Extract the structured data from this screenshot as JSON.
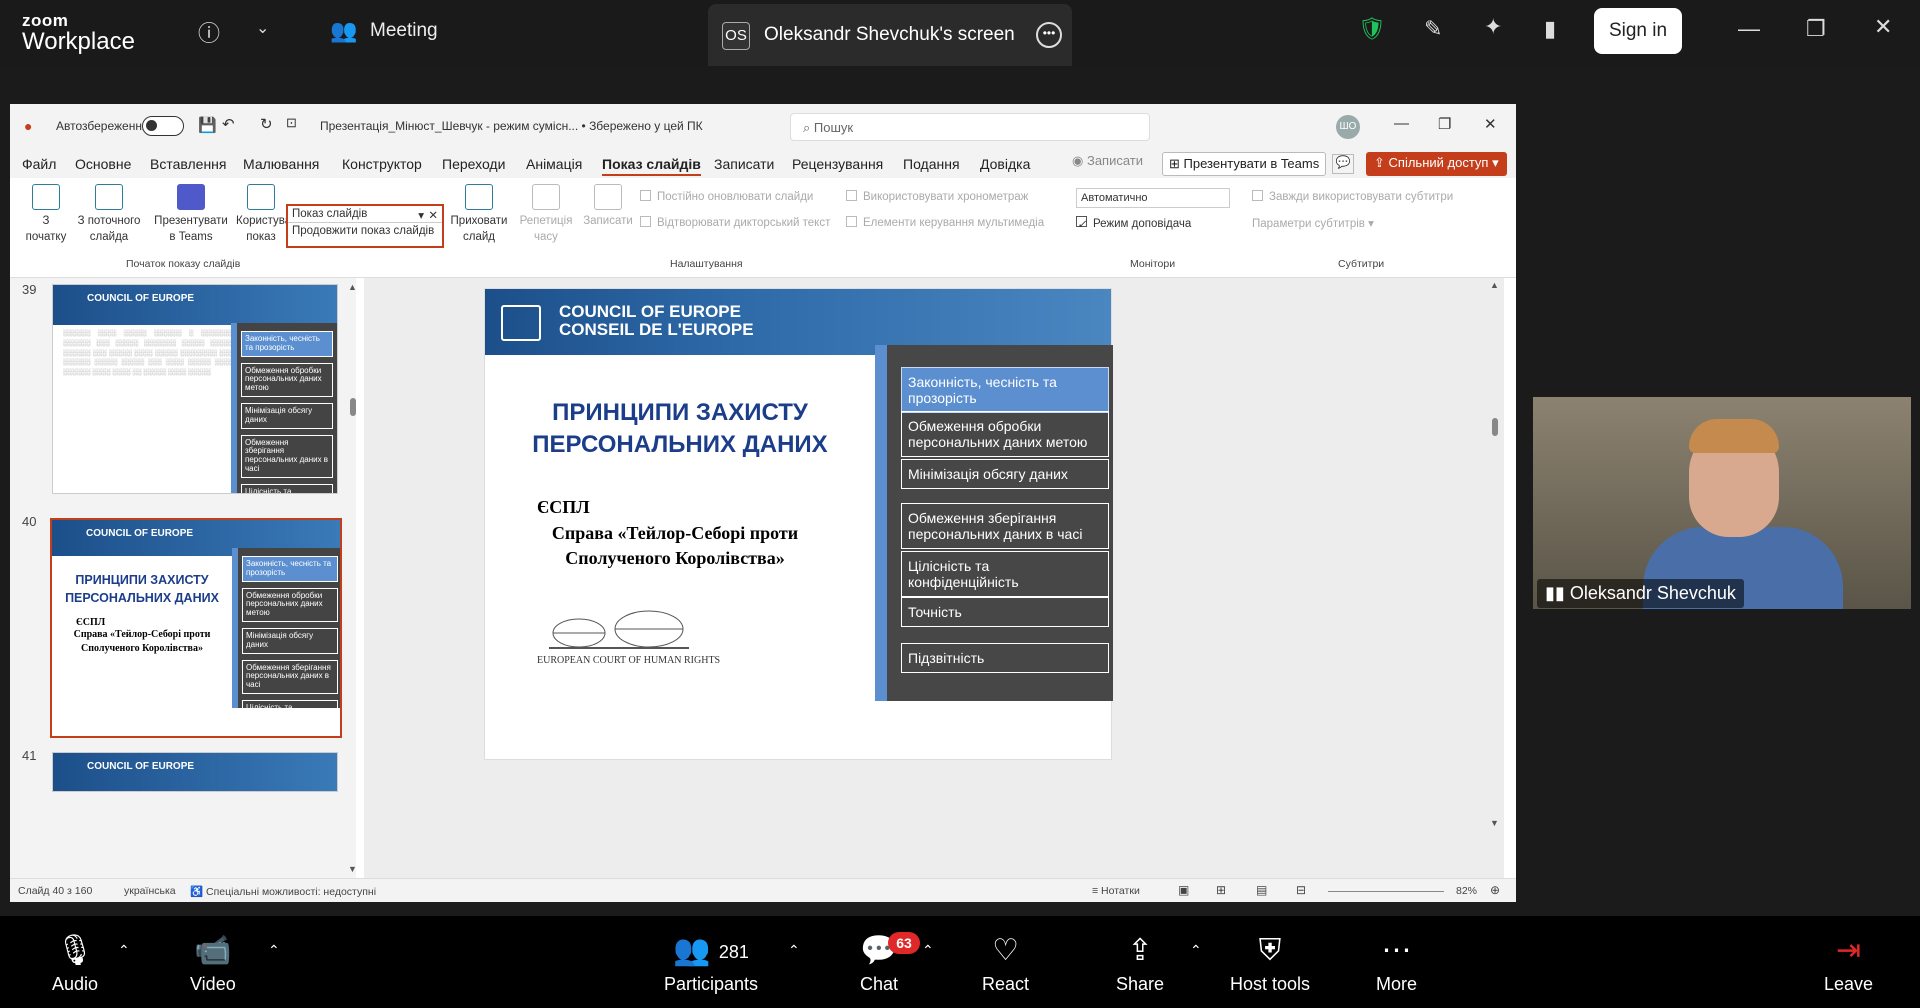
{
  "zoom": {
    "brand_top": "zoom",
    "brand_bottom": "Workplace",
    "meeting_label": "Meeting",
    "screen_initials": "OS",
    "screen_title": "Oleksandr Shevchuk's screen",
    "sign_in": "Sign in"
  },
  "ppt": {
    "autosave": "Автозбереження",
    "filename": "Презентація_Мінюст_Шевчук  -  режим сумісн...  •  Збережено у цей ПК",
    "search_placeholder": "Пошук",
    "user_initials": "ШО",
    "menu": [
      "Файл",
      "Основне",
      "Вставлення",
      "Малювання",
      "Конструктор",
      "Переходи",
      "Анімація",
      "Показ слайдів",
      "Записати",
      "Рецензування",
      "Подання",
      "Довідка"
    ],
    "record_label": "Записати",
    "present_teams": "Презентувати в Teams",
    "share": "Спільний доступ",
    "ribbon": {
      "from_start": "З початку",
      "from_current": "З поточного слайда",
      "present_in_teams": "Презентувати в Teams",
      "custom_show": "Користувацький показ",
      "hide_slide": "Приховати слайд",
      "rehearse": "Репетиція часу",
      "record": "Записати",
      "group_start": "Початок показу слайдів",
      "group_settings": "Налаштування",
      "group_monitors": "Монітори",
      "group_captions": "Субтитри",
      "chk_loop": "Постійно оновлювати слайди",
      "chk_narration": "Відтворювати дикторський текст",
      "chk_timings": "Використовувати хронометраж",
      "chk_media": "Елементи керування мультимедіа",
      "monitor_value": "Автоматично",
      "chk_presenter": "Режим доповідача",
      "chk_captions": "Завжди використовувати субтитри",
      "caption_settings": "Параметри субтитрів",
      "dropdown_title": "Показ слайдів",
      "dropdown_item": "Продовжити показ слайдів"
    },
    "thumb_numbers": [
      "39",
      "40",
      "41"
    ],
    "coe_line1": "COUNCIL OF EUROPE",
    "coe_line2": "CONSEIL DE L'EUROPE",
    "slide": {
      "title": "ПРИНЦИПИ ЗАХИСТУ ПЕРСОНАЛЬНИХ ДАНИХ",
      "espl": "ЄСПЛ",
      "case": "Справа «Тейлор-Себорі проти Сполученого Королівства»",
      "court": "EUROPEAN COURT OF HUMAN RIGHTS",
      "principles": [
        "Законність, чесність та прозорість",
        "Обмеження обробки персональних даних метою",
        "Мінімізація обсягу даних",
        "Обмеження зберігання персональних даних в часі",
        "Цілісність та конфіденційність",
        "Точність",
        "Підзвітність"
      ]
    },
    "status": {
      "slide_count": "Слайд 40 з 160",
      "language": "українська",
      "accessibility": "Спеціальні можливості: недоступні",
      "notes": "Нотатки",
      "zoom_pct": "82%"
    }
  },
  "video": {
    "name": "Oleksandr Shevchuk"
  },
  "toolbar": {
    "audio": "Audio",
    "video": "Video",
    "participants": "Participants",
    "participants_count": "281",
    "chat": "Chat",
    "chat_badge": "63",
    "react": "React",
    "share": "Share",
    "host_tools": "Host tools",
    "more": "More",
    "leave": "Leave"
  }
}
